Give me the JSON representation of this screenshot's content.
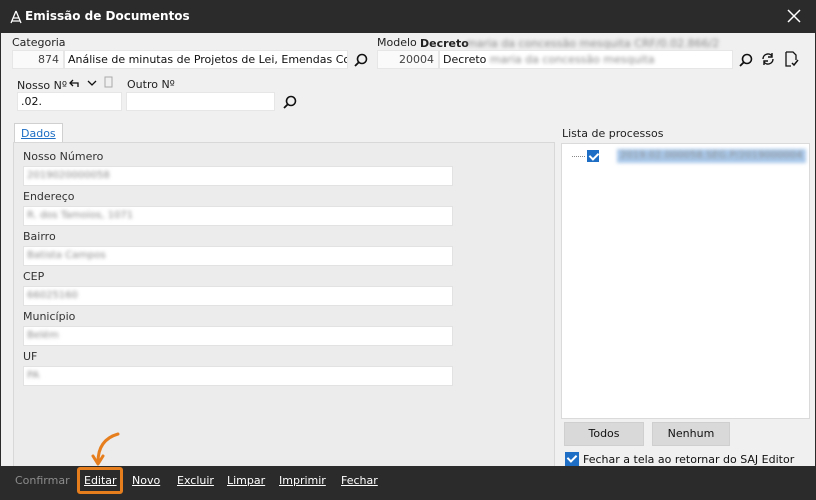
{
  "window": {
    "title": "Emissão de Documentos"
  },
  "categoria": {
    "label": "Categoria",
    "code": "874",
    "value": "Análise de minutas de Projetos de Lei, Emendas Con"
  },
  "modelo": {
    "label": "Modelo",
    "header_bold": "Decreto",
    "header_blur": "maria da concessão mesquita CRF/0.02.866/2",
    "code": "20004",
    "value_prefix": "Decreto",
    "value_blur": "maria da concessão mesquita"
  },
  "nosso": {
    "label": "Nosso Nº",
    "value": ".02."
  },
  "outro": {
    "label": "Outro Nº",
    "value": ""
  },
  "tab": {
    "label": "Dados"
  },
  "fields": [
    {
      "label": "Nosso Número",
      "value": "2019020000058"
    },
    {
      "label": "Endereço",
      "value": "R. dos Tamoios, 1071"
    },
    {
      "label": "Bairro",
      "value": "Batista Campos"
    },
    {
      "label": "CEP",
      "value": "66025160"
    },
    {
      "label": "Município",
      "value": "Belém"
    },
    {
      "label": "UF",
      "value": "PA"
    }
  ],
  "processos": {
    "label": "Lista de processos",
    "items": [
      {
        "text": "2019.02.000058.SEG.P/2019000004",
        "checked": true
      }
    ]
  },
  "buttons": {
    "todos": "Todos",
    "nenhum": "Nenhum"
  },
  "fechar_tela": {
    "label": "Fechar a tela ao retornar do SAJ Editor",
    "checked": true
  },
  "footer": {
    "confirmar": "Confirmar",
    "editar": "Editar",
    "novo": "Novo",
    "excluir": "Excluir",
    "limpar": "Limpar",
    "imprimir": "Imprimir",
    "fechar": "Fechar"
  },
  "icons": {
    "search": "search-icon",
    "undo": "undo-icon",
    "chevron": "chevron-down-icon",
    "copy": "copy-icon",
    "refresh": "refresh-icon",
    "doc_check": "document-check-icon",
    "close": "close-icon",
    "app": "app-icon"
  },
  "colors": {
    "accent": "#1d6ec4",
    "highlight": "#e67e1e",
    "titlebar": "#2b2b2b"
  }
}
